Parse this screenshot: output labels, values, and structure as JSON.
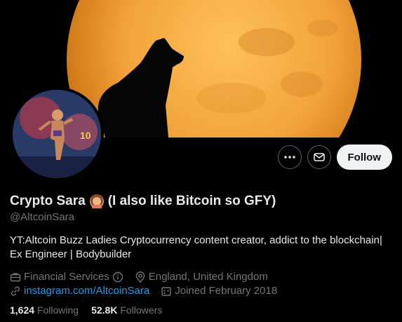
{
  "banner": {
    "moon_color": "#f2a23a"
  },
  "profile": {
    "display_name": "Crypto Sara",
    "name_suffix": "(I also like Bitcoin so GFY)",
    "handle": "@AltcoinSara",
    "bio": "YT:Altcoin Buzz Ladies Cryptocurrency content creator, addict to the blockchain| Ex Engineer | Bodybuilder",
    "category": "Financial Services",
    "location": "England, United Kingdom",
    "website": "instagram.com/AltcoinSara",
    "joined": "Joined February 2018",
    "following_count": "1,624",
    "following_label": "Following",
    "followers_count": "52.8K",
    "followers_label": "Followers"
  },
  "actions": {
    "more_icon": "ellipsis-icon",
    "message_icon": "envelope-icon",
    "follow_label": "Follow"
  },
  "colors": {
    "link": "#1d9bf0",
    "muted": "#71767b",
    "text": "#e7e9ea"
  }
}
